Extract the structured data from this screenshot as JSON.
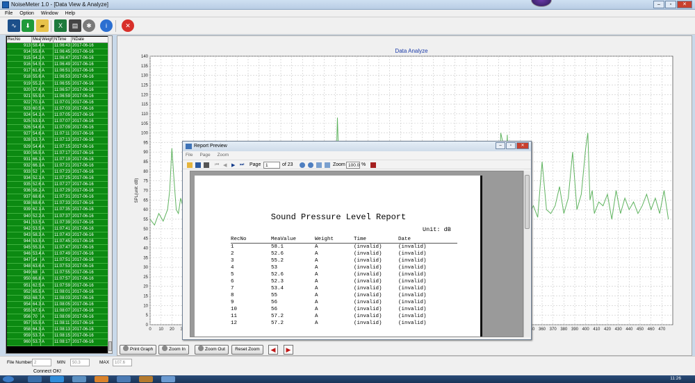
{
  "window": {
    "title": "NoiseMeter 1.0  - [Data View & Analyze]"
  },
  "menu": [
    "File",
    "Option",
    "Window",
    "Help"
  ],
  "toolbar_icons": [
    "wave-icon",
    "download-icon",
    "folder-icon",
    "excel-icon",
    "printer-icon",
    "gear-icon",
    "info-icon",
    "stop-icon"
  ],
  "grid": {
    "headers": [
      "RecNo",
      "MeaVal",
      "Weigh",
      "NTime",
      "NDate"
    ],
    "rows": [
      [
        "913",
        "58.4",
        "A",
        "11:06:43",
        "2017-06-16"
      ],
      [
        "914",
        "55.8",
        "A",
        "11:06:45",
        "2017-06-16"
      ],
      [
        "915",
        "54.2",
        "A",
        "11:06:47",
        "2017-06-16"
      ],
      [
        "916",
        "54.5",
        "A",
        "11:06:49",
        "2017-06-16"
      ],
      [
        "917",
        "61.6",
        "A",
        "11:06:51",
        "2017-06-16"
      ],
      [
        "918",
        "55.6",
        "A",
        "11:06:53",
        "2017-06-16"
      ],
      [
        "919",
        "55.2",
        "A",
        "11:06:55",
        "2017-06-16"
      ],
      [
        "920",
        "57.6",
        "A",
        "11:06:57",
        "2017-06-16"
      ],
      [
        "921",
        "55.9",
        "A",
        "11:06:59",
        "2017-06-16"
      ],
      [
        "922",
        "70.1",
        "A",
        "11:07:01",
        "2017-06-16"
      ],
      [
        "923",
        "60.5",
        "A",
        "11:07:03",
        "2017-06-16"
      ],
      [
        "924",
        "54.1",
        "A",
        "11:07:05",
        "2017-06-16"
      ],
      [
        "925",
        "53.9",
        "A",
        "11:07:07",
        "2017-06-16"
      ],
      [
        "926",
        "54.6",
        "A",
        "11:07:09",
        "2017-06-16"
      ],
      [
        "927",
        "54.6",
        "A",
        "11:07:11",
        "2017-06-16"
      ],
      [
        "928",
        "53.7",
        "A",
        "11:07:13",
        "2017-06-16"
      ],
      [
        "929",
        "54.4",
        "A",
        "11:07:15",
        "2017-06-16"
      ],
      [
        "930",
        "56.5",
        "A",
        "11:07:17",
        "2017-06-16"
      ],
      [
        "931",
        "66.1",
        "A",
        "11:07:19",
        "2017-06-16"
      ],
      [
        "932",
        "66.1",
        "A",
        "11:07:21",
        "2017-06-16"
      ],
      [
        "933",
        "52",
        "A",
        "11:07:23",
        "2017-06-16"
      ],
      [
        "934",
        "52.1",
        "A",
        "11:07:25",
        "2017-06-16"
      ],
      [
        "935",
        "52.6",
        "A",
        "11:07:27",
        "2017-06-16"
      ],
      [
        "936",
        "56.2",
        "A",
        "11:07:29",
        "2017-06-16"
      ],
      [
        "937",
        "68.6",
        "A",
        "11:07:31",
        "2017-06-16"
      ],
      [
        "938",
        "68.6",
        "A",
        "11:07:33",
        "2017-06-16"
      ],
      [
        "939",
        "62.1",
        "A",
        "11:07:35",
        "2017-06-16"
      ],
      [
        "940",
        "52.2",
        "A",
        "11:07:37",
        "2017-06-16"
      ],
      [
        "941",
        "53.5",
        "A",
        "11:07:39",
        "2017-06-16"
      ],
      [
        "942",
        "53.5",
        "A",
        "11:07:41",
        "2017-06-16"
      ],
      [
        "943",
        "58.3",
        "A",
        "11:07:43",
        "2017-06-16"
      ],
      [
        "944",
        "53.5",
        "A",
        "11:07:45",
        "2017-06-16"
      ],
      [
        "945",
        "55.3",
        "A",
        "11:07:47",
        "2017-06-16"
      ],
      [
        "946",
        "53.4",
        "A",
        "11:07:49",
        "2017-06-16"
      ],
      [
        "947",
        "54",
        "A",
        "11:07:51",
        "2017-06-16"
      ],
      [
        "948",
        "63.6",
        "A",
        "11:07:53",
        "2017-06-16"
      ],
      [
        "949",
        "68",
        "A",
        "11:07:55",
        "2017-06-16"
      ],
      [
        "950",
        "66.8",
        "A",
        "11:07:57",
        "2017-06-16"
      ],
      [
        "951",
        "62.5",
        "A",
        "11:07:59",
        "2017-06-16"
      ],
      [
        "952",
        "65.5",
        "A",
        "11:08:01",
        "2017-06-16"
      ],
      [
        "953",
        "68.7",
        "A",
        "11:08:03",
        "2017-06-16"
      ],
      [
        "954",
        "64.3",
        "A",
        "11:08:05",
        "2017-06-16"
      ],
      [
        "955",
        "67.9",
        "A",
        "11:08:07",
        "2017-06-16"
      ],
      [
        "956",
        "70",
        "A",
        "11:08:09",
        "2017-06-16"
      ],
      [
        "957",
        "55.5",
        "A",
        "11:08:11",
        "2017-06-16"
      ],
      [
        "958",
        "64.3",
        "A",
        "11:08:13",
        "2017-06-16"
      ],
      [
        "959",
        "53.7",
        "A",
        "11:08:15",
        "2017-06-16"
      ],
      [
        "960",
        "53.7",
        "A",
        "11:08:17",
        "2017-06-16"
      ]
    ]
  },
  "chart_data": {
    "type": "line",
    "title": "Data Analyze",
    "ylabel": "SPL(unit: dB)",
    "xlabel": "",
    "ylim": [
      0,
      140
    ],
    "yticks": [
      0,
      5,
      10,
      15,
      20,
      25,
      30,
      35,
      40,
      45,
      50,
      55,
      60,
      65,
      70,
      75,
      80,
      85,
      90,
      95,
      100,
      105,
      110,
      115,
      120,
      125,
      130,
      135,
      140
    ],
    "xlim": [
      0,
      480
    ],
    "xticks": [
      0,
      10,
      20,
      30,
      40,
      50,
      60,
      70,
      80,
      90,
      100,
      110,
      120,
      130,
      140,
      150,
      160,
      170,
      180,
      190,
      200,
      210,
      220,
      230,
      240,
      250,
      260,
      270,
      280,
      290,
      300,
      310,
      320,
      330,
      340,
      350,
      360,
      370,
      380,
      390,
      400,
      410,
      420,
      430,
      440,
      450,
      460,
      470
    ],
    "grid": true,
    "color": "#5fb35f",
    "series": [
      {
        "x": [
          0,
          4,
          8,
          12,
          16,
          18,
          20,
          22,
          24,
          26,
          28,
          30,
          32,
          34,
          36,
          40,
          44,
          48,
          52,
          56,
          60,
          64,
          68,
          70,
          72,
          76,
          80,
          84,
          88,
          92,
          96,
          100,
          104,
          108,
          112,
          116,
          120,
          124,
          128,
          132,
          136,
          140,
          144,
          148,
          152,
          156,
          160,
          164,
          168,
          170,
          172,
          174,
          176,
          180,
          184,
          188,
          192,
          196,
          200,
          204,
          208,
          212,
          216,
          220,
          224,
          228,
          232,
          236,
          240,
          244,
          248,
          252,
          256,
          260,
          264,
          268,
          272,
          276,
          280,
          284,
          288,
          292,
          296,
          300,
          304,
          308,
          312,
          316,
          320,
          322,
          324,
          326,
          328,
          330,
          332,
          334,
          336,
          340,
          344,
          348,
          352,
          356,
          360,
          364,
          368,
          372,
          376,
          380,
          384,
          388,
          392,
          396,
          400,
          402,
          404,
          406,
          408,
          412,
          416,
          420,
          424,
          428,
          432,
          436,
          440,
          444,
          448,
          452,
          456,
          460,
          464,
          468,
          472,
          476
        ],
        "y": [
          55,
          52,
          58,
          54,
          60,
          70,
          92,
          75,
          60,
          58,
          66,
          62,
          56,
          53,
          55,
          52,
          54,
          57,
          55,
          56,
          54,
          55,
          53,
          56,
          55,
          54,
          56,
          54,
          55,
          53,
          54,
          56,
          55,
          54,
          56,
          55,
          53,
          54,
          55,
          57,
          55,
          54,
          56,
          55,
          54,
          55,
          56,
          55,
          57,
          65,
          108,
          70,
          58,
          56,
          55,
          54,
          56,
          55,
          54,
          55,
          56,
          55,
          54,
          55,
          56,
          57,
          55,
          56,
          54,
          55,
          56,
          57,
          58,
          55,
          56,
          55,
          54,
          56,
          55,
          60,
          58,
          56,
          57,
          55,
          56,
          58,
          57,
          56,
          57,
          100,
          95,
          70,
          99,
          58,
          88,
          62,
          58,
          57,
          60,
          58,
          62,
          56,
          85,
          60,
          58,
          62,
          72,
          58,
          66,
          90,
          60,
          68,
          92,
          100,
          65,
          70,
          58,
          64,
          62,
          68,
          55,
          70,
          58,
          66,
          60,
          64,
          58,
          62,
          68,
          60,
          66,
          58,
          70,
          55
        ]
      }
    ]
  },
  "buttons": {
    "print_graph": "Print Graph",
    "zoom_in": "Zoom In",
    "zoom_out": "Zoom Out",
    "reset_zoom": "Reset Zoom"
  },
  "status": {
    "file_numbers_label": "File Numbers",
    "file_numbers_value": "2",
    "min_label": "MIN",
    "min_value": "50.3",
    "max_label": "MAX",
    "max_value": "107.6",
    "connect": "Connect OK!"
  },
  "clock": "11:26",
  "dialog": {
    "title": "Report Preview",
    "menu": [
      "File",
      "Page",
      "Zoom"
    ],
    "page_label": "Page",
    "page_value": "1",
    "of_pages": "of 23",
    "zoom_label": "Zoom",
    "zoom_value": "100.0",
    "percent": "%",
    "report": {
      "title": "Sound Pressure Level Report",
      "unit": "Unit: dB",
      "headers": [
        "RecNo",
        "MeaValue",
        "Weight",
        "Time",
        "Date"
      ],
      "rows": [
        [
          "1",
          "58.1",
          "A",
          "(invalid)",
          "(invalid)"
        ],
        [
          "2",
          "52.6",
          "A",
          "(invalid)",
          "(invalid)"
        ],
        [
          "3",
          "55.2",
          "A",
          "(invalid)",
          "(invalid)"
        ],
        [
          "4",
          "53",
          "A",
          "(invalid)",
          "(invalid)"
        ],
        [
          "5",
          "52.6",
          "A",
          "(invalid)",
          "(invalid)"
        ],
        [
          "6",
          "52.3",
          "A",
          "(invalid)",
          "(invalid)"
        ],
        [
          "7",
          "53.4",
          "A",
          "(invalid)",
          "(invalid)"
        ],
        [
          "8",
          "55",
          "A",
          "(invalid)",
          "(invalid)"
        ],
        [
          "9",
          "56",
          "A",
          "(invalid)",
          "(invalid)"
        ],
        [
          "10",
          "56",
          "A",
          "(invalid)",
          "(invalid)"
        ],
        [
          "11",
          "57.2",
          "A",
          "(invalid)",
          "(invalid)"
        ],
        [
          "12",
          "57.2",
          "A",
          "(invalid)",
          "(invalid)"
        ]
      ]
    }
  }
}
